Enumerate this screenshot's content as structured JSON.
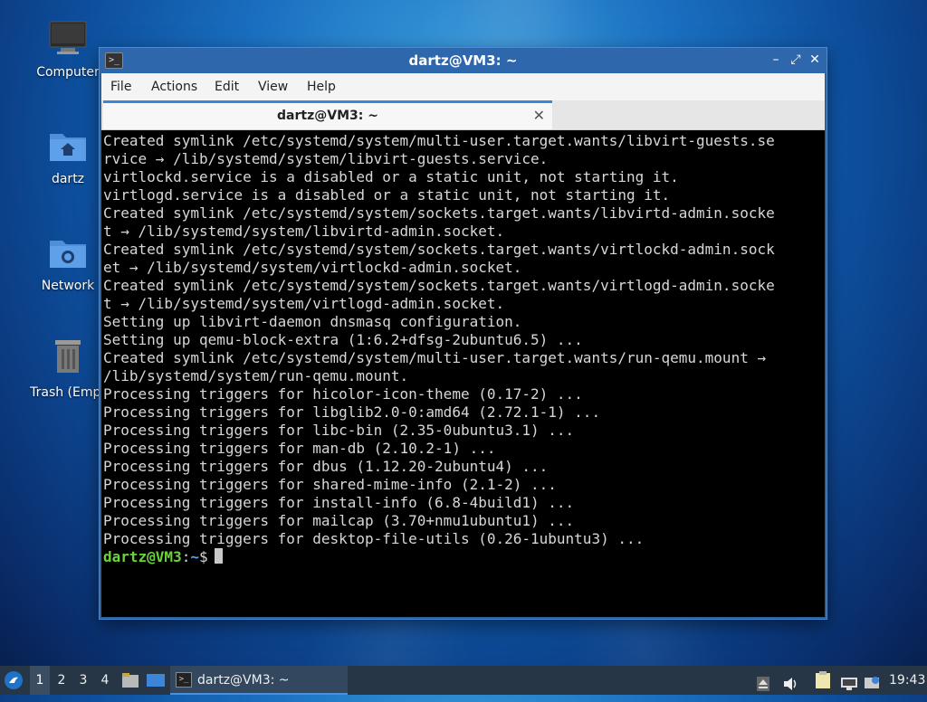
{
  "desktop": {
    "icons": [
      {
        "label": "Computer"
      },
      {
        "label": "dartz"
      },
      {
        "label": "Network"
      },
      {
        "label": "Trash (Empt"
      }
    ]
  },
  "window": {
    "title": "dartz@VM3: ~",
    "menu": [
      "File",
      "Actions",
      "Edit",
      "View",
      "Help"
    ],
    "tab_label": "dartz@VM3: ~",
    "terminal_lines": [
      "Created symlink /etc/systemd/system/multi-user.target.wants/libvirt-guests.se",
      "rvice → /lib/systemd/system/libvirt-guests.service.",
      "virtlockd.service is a disabled or a static unit, not starting it.",
      "virtlogd.service is a disabled or a static unit, not starting it.",
      "Created symlink /etc/systemd/system/sockets.target.wants/libvirtd-admin.socke",
      "t → /lib/systemd/system/libvirtd-admin.socket.",
      "Created symlink /etc/systemd/system/sockets.target.wants/virtlockd-admin.sock",
      "et → /lib/systemd/system/virtlockd-admin.socket.",
      "Created symlink /etc/systemd/system/sockets.target.wants/virtlogd-admin.socke",
      "t → /lib/systemd/system/virtlogd-admin.socket.",
      "Setting up libvirt-daemon dnsmasq configuration.",
      "Setting up qemu-block-extra (1:6.2+dfsg-2ubuntu6.5) ...",
      "Created symlink /etc/systemd/system/multi-user.target.wants/run-qemu.mount →",
      "/lib/systemd/system/run-qemu.mount.",
      "Processing triggers for hicolor-icon-theme (0.17-2) ...",
      "Processing triggers for libglib2.0-0:amd64 (2.72.1-1) ...",
      "Processing triggers for libc-bin (2.35-0ubuntu3.1) ...",
      "Processing triggers for man-db (2.10.2-1) ...",
      "Processing triggers for dbus (1.12.20-2ubuntu4) ...",
      "Processing triggers for shared-mime-info (2.1-2) ...",
      "Processing triggers for install-info (6.8-4build1) ...",
      "Processing triggers for mailcap (3.70+nmu1ubuntu1) ...",
      "Processing triggers for desktop-file-utils (0.26-1ubuntu3) ..."
    ],
    "prompt": {
      "user": "dartz@VM3",
      "sep": ":",
      "path": "~",
      "symbol": "$"
    }
  },
  "taskbar": {
    "workspaces": [
      "1",
      "2",
      "3",
      "4"
    ],
    "active_workspace": "1",
    "task_label": "dartz@VM3: ~",
    "clock": "19:43"
  },
  "colors": {
    "prompt_user": "#6ad43b",
    "prompt_path": "#5ea1f0",
    "accent": "#3d85d8"
  }
}
